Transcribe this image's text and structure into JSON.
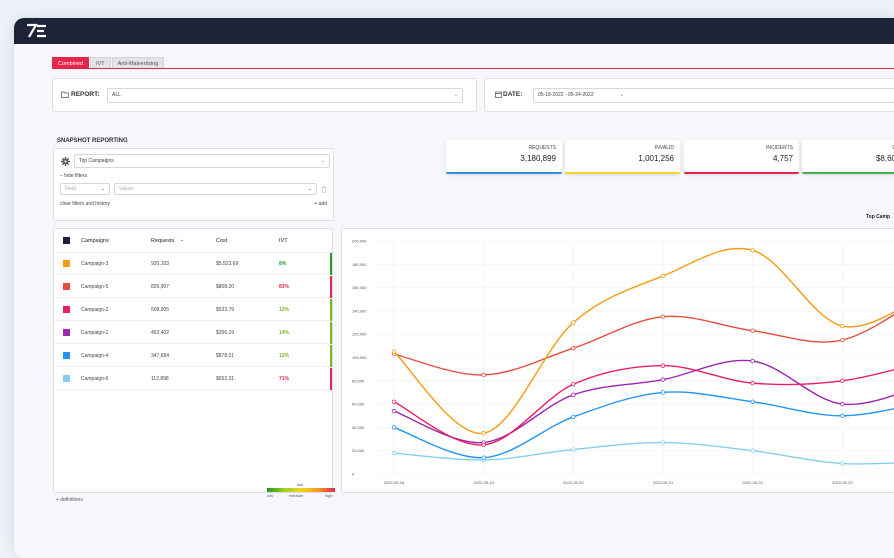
{
  "tabs": [
    "Combined",
    "IVT",
    "Anti-Malvertising"
  ],
  "report": {
    "label": "REPORT:",
    "value": "ALL"
  },
  "date": {
    "label": "DATE:",
    "value": "05-18-2022  -  05-24-2022"
  },
  "snapshot": {
    "title": "SNAPSHOT REPORTING",
    "selector": "Top Campaigns",
    "hide_filters": "– hide filters",
    "field_placeholder": "Field",
    "values_placeholder": "Values",
    "clear": "clear filters and history",
    "add": "+ add"
  },
  "stats": [
    {
      "label": "REQUESTS",
      "value": "3,180,899",
      "color": "#3a8fdc"
    },
    {
      "label": "INVALID",
      "value": "1,001,256",
      "color": "#f2d430"
    },
    {
      "label": "INCIDENTS",
      "value": "4,757",
      "color": "#e8254b"
    },
    {
      "label": "C",
      "value": "$8,60",
      "color": "#4caf50"
    }
  ],
  "table": {
    "headers": [
      "Campaigns",
      "Requests",
      "Cost",
      "IVT"
    ],
    "rows": [
      {
        "name": "Campaign-3",
        "requests": "920,103",
        "cost": "$5,523.69",
        "ivt": "8%",
        "color": "#f39c12",
        "ivt_color": "#2a9d2a"
      },
      {
        "name": "Campaign-5",
        "requests": "826,907",
        "cost": "$808.20",
        "ivt": "83%",
        "color": "#e74c3c",
        "ivt_color": "#e8254b"
      },
      {
        "name": "Campaign-2",
        "requests": "509,905",
        "cost": "$533.79",
        "ivt": "12%",
        "color": "#e91e63",
        "ivt_color": "#7cb518"
      },
      {
        "name": "Campaign-1",
        "requests": "463,402",
        "cost": "$206.19",
        "ivt": "14%",
        "color": "#9c27b0",
        "ivt_color": "#7cb518"
      },
      {
        "name": "Campaign-4",
        "requests": "347,684",
        "cost": "$878.01",
        "ivt": "12%",
        "color": "#2196f3",
        "ivt_color": "#7cb518"
      },
      {
        "name": "Campaign-6",
        "requests": "112,898",
        "cost": "$652.31",
        "ivt": "71%",
        "color": "#87ceeb",
        "ivt_color": "#e8254b"
      }
    ]
  },
  "chart_title": "Top Camp",
  "definitions": "+ definitions",
  "risk_legend": {
    "title": "risk",
    "low": "low",
    "medium": "medium",
    "high": "high"
  },
  "chart_data": {
    "type": "line",
    "x": [
      "2022-05-18",
      "2022-05-19",
      "2022-05-20",
      "2022-05-21",
      "2022-05-22",
      "2022-05-23",
      "2022-0"
    ],
    "ylim": [
      0,
      200000
    ],
    "yticks": [
      "0",
      "20,000",
      "40,000",
      "60,000",
      "80,000",
      "100,000",
      "120,000",
      "140,000",
      "160,000",
      "180,000",
      "200,000"
    ],
    "grid": true,
    "series": [
      {
        "name": "Campaign-3",
        "color": "#f39c12",
        "values": [
          105000,
          35000,
          130000,
          170000,
          192000,
          127000,
          158000
        ]
      },
      {
        "name": "Campaign-5",
        "color": "#e74c3c",
        "values": [
          103000,
          85000,
          108000,
          135000,
          123000,
          115000,
          158000
        ]
      },
      {
        "name": "Campaign-2",
        "color": "#e91e63",
        "values": [
          62000,
          25000,
          77000,
          93000,
          78000,
          80000,
          98000
        ]
      },
      {
        "name": "Campaign-1",
        "color": "#9c27b0",
        "values": [
          54000,
          27000,
          68000,
          81000,
          97000,
          60000,
          79000
        ]
      },
      {
        "name": "Campaign-4",
        "color": "#2196f3",
        "values": [
          40000,
          14000,
          49000,
          70000,
          62000,
          50000,
          63000
        ]
      },
      {
        "name": "Campaign-6",
        "color": "#87ceeb",
        "values": [
          18000,
          12000,
          21000,
          27000,
          20000,
          9000,
          11000
        ]
      }
    ]
  }
}
